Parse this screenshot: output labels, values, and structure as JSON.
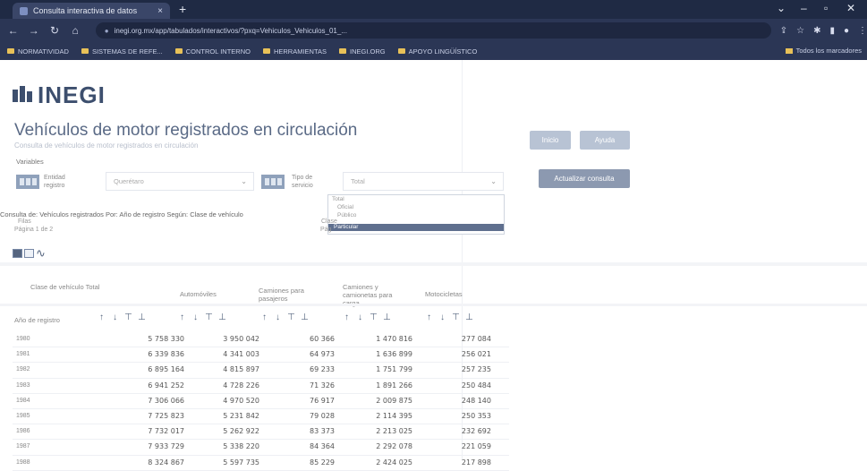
{
  "browser": {
    "tab_title": "Consulta interactiva de datos",
    "tab_close": "×",
    "new_tab": "+",
    "url": "inegi.org.mx/app/tabulados/interactivos/?pxq=Vehiculos_Vehiculos_01_...",
    "bookmarks": [
      "NORMATIVIDAD",
      "SISTEMAS DE REFE...",
      "CONTROL INTERNO",
      "HERRAMIENTAS",
      "INEGI.ORG",
      "APOYO LINGÜÍSTICO"
    ],
    "bookmarks_right": "Todos los marcadores"
  },
  "page": {
    "logo": "INEGI",
    "title": "Vehículos de motor registrados en circulación",
    "subtitle": "Consulta de vehículos de motor registrados en circulación",
    "variables_label": "Variables",
    "buttons": {
      "clear": "Inicio",
      "help": "Ayuda",
      "update": "Actualizar consulta"
    },
    "var1": {
      "label": "Entidad\nregistro",
      "value": "Querétaro"
    },
    "var2": {
      "label": "Tipo de\nservicio",
      "value": "Total"
    },
    "dropdown_options": [
      "Total",
      "Oficial",
      "Público",
      "Particular"
    ],
    "dropdown_selected_index": 3,
    "query_text": "Consulta de: Vehículos registrados   Por: Año de registro   Según: Clase de vehículo",
    "filas": "Filas",
    "pagina": "Página  1  de 2",
    "clase_label": "Clase",
    "pag_label": "Pág"
  },
  "table": {
    "row_header": "Año de registro",
    "columns": [
      "Clase de vehículo  Total",
      "Automóviles",
      "Camiones para pasajeros",
      "Camiones y camionetas para carga",
      "Motocicletas"
    ],
    "rows": [
      {
        "year": "1980",
        "total": "5 758 330",
        "autos": "3 950 042",
        "pasajeros": "60 366",
        "carga": "1 470 816",
        "motos": "277 084"
      },
      {
        "year": "1981",
        "total": "6 339 836",
        "autos": "4 341 003",
        "pasajeros": "64 973",
        "carga": "1 636 899",
        "motos": "256 021"
      },
      {
        "year": "1982",
        "total": "6 895 164",
        "autos": "4 815 897",
        "pasajeros": "69 233",
        "carga": "1 751 799",
        "motos": "257 235"
      },
      {
        "year": "1983",
        "total": "6 941 252",
        "autos": "4 728 226",
        "pasajeros": "71 326",
        "carga": "1 891 266",
        "motos": "250 484"
      },
      {
        "year": "1984",
        "total": "7 306 066",
        "autos": "4 970 520",
        "pasajeros": "76 917",
        "carga": "2 009 875",
        "motos": "248 140"
      },
      {
        "year": "1985",
        "total": "7 725 823",
        "autos": "5 231 842",
        "pasajeros": "79 028",
        "carga": "2 114 395",
        "motos": "250 353"
      },
      {
        "year": "1986",
        "total": "7 732 017",
        "autos": "5 262 922",
        "pasajeros": "83 373",
        "carga": "2 213 025",
        "motos": "232 692"
      },
      {
        "year": "1987",
        "total": "7 933 729",
        "autos": "5 338 220",
        "pasajeros": "84 364",
        "carga": "2 292 078",
        "motos": "221 059"
      },
      {
        "year": "1988",
        "total": "8 324 867",
        "autos": "5 597 735",
        "pasajeros": "85 229",
        "carga": "2 424 025",
        "motos": "217 898"
      }
    ]
  }
}
